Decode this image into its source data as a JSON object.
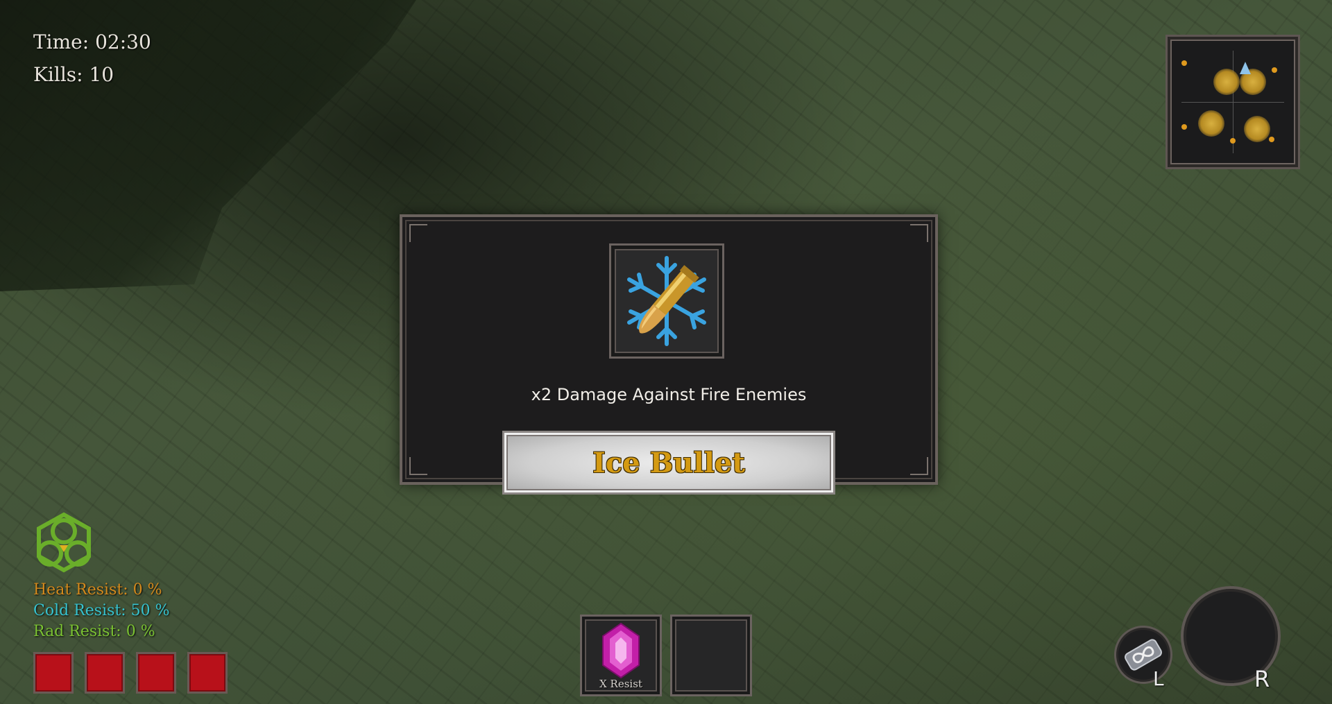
{
  "hud": {
    "time_text": "Time: 02:30",
    "kills_text": "Kills: 10"
  },
  "minimap": {
    "label_icon": "minimap"
  },
  "dialog": {
    "item_icon": "ice-bullet-icon",
    "description": "x2 Damage Against Fire Enemies",
    "item_name": "Ice Bullet"
  },
  "resists": {
    "heat": "Heat Resist:  0 %",
    "cold": "Cold Resist:  50 %",
    "rad": "Rad Resist:   0 %"
  },
  "health": {
    "cells": 4
  },
  "inventory": {
    "slot1_label": "X Resist",
    "slot1_icon": "pink-crystal-icon"
  },
  "controls": {
    "left_key": "L",
    "right_key": "R"
  },
  "colors": {
    "heat": "#d58a1d",
    "cold": "#37c3cf",
    "rad": "#7bc233",
    "item_name": "#d49a12",
    "health": "#b8111a"
  }
}
